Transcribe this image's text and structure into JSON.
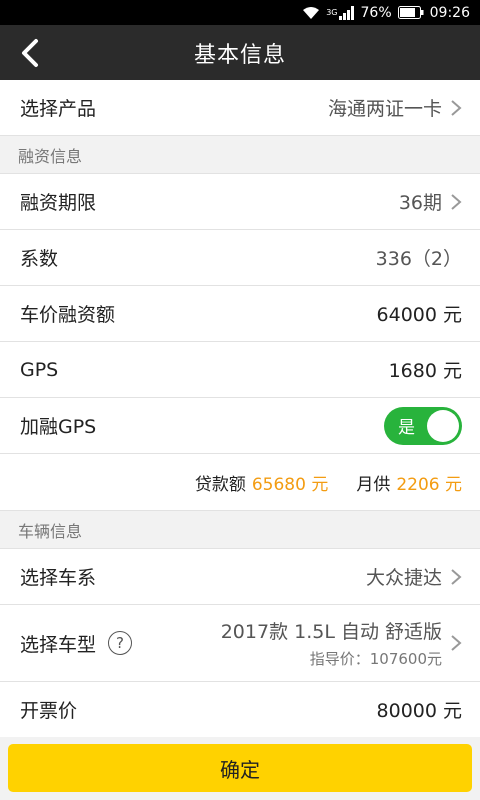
{
  "status_bar": {
    "network": "3G",
    "battery": "76%",
    "time": "09:26",
    "icons": [
      "wifi-icon",
      "signal-icon",
      "battery-icon"
    ]
  },
  "header": {
    "title": "基本信息",
    "back_icon": "back-arrow-icon"
  },
  "product": {
    "label": "选择产品",
    "value": "海通两证一卡"
  },
  "financing_section": {
    "title": "融资信息"
  },
  "financing": {
    "term": {
      "label": "融资期限",
      "value": "36期"
    },
    "coefficient": {
      "label": "系数",
      "value": "336（2）"
    },
    "car_price_financing": {
      "label": "车价融资额",
      "value": "64000 元"
    },
    "gps": {
      "label": "GPS",
      "value": "1680 元"
    },
    "finance_gps": {
      "label": "加融GPS",
      "toggle_text": "是",
      "on": true
    }
  },
  "summary": {
    "loan_label": "贷款额",
    "loan_value": "65680 元",
    "monthly_label": "月供",
    "monthly_value": "2206 元",
    "accent": "#f39c12"
  },
  "vehicle_section": {
    "title": "车辆信息"
  },
  "vehicle": {
    "series": {
      "label": "选择车系",
      "value": "大众捷达"
    },
    "model": {
      "label": "选择车型",
      "help": "?",
      "value": "2017款 1.5L 自动 舒适版",
      "guide_price": "指导价：107600元"
    },
    "invoice_price": {
      "label": "开票价",
      "value": "80000 元"
    }
  },
  "confirm": {
    "label": "确定",
    "color": "#ffd200"
  }
}
